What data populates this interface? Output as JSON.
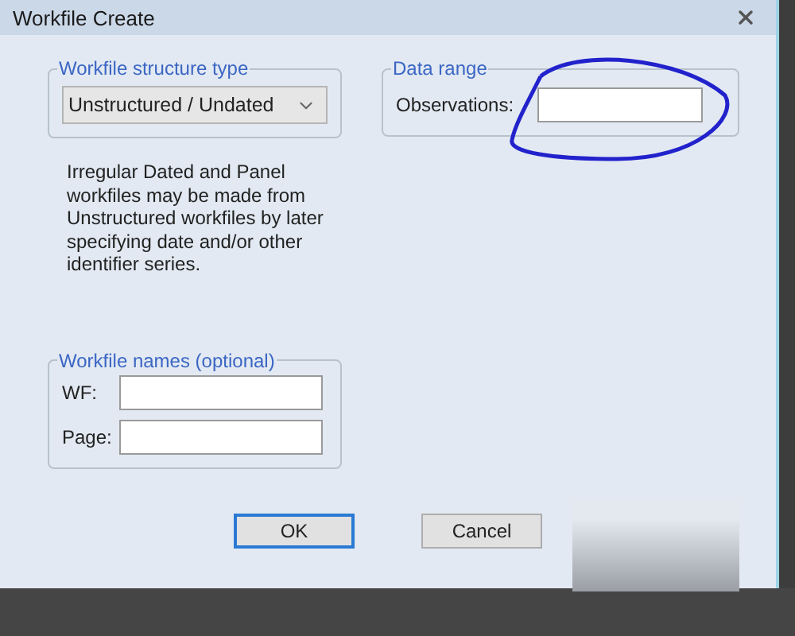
{
  "window": {
    "title": "Workfile Create"
  },
  "structure_group": {
    "label": "Workfile structure type",
    "dropdown": {
      "value": "Unstructured / Undated"
    }
  },
  "description": "Irregular Dated and Panel workfiles may be made from Unstructured workfiles by later specifying date and/or other identifier series.",
  "data_range": {
    "label": "Data range",
    "fields": [
      {
        "label": "Observations:"
      }
    ]
  },
  "names_group": {
    "label": "Workfile names (optional)",
    "fields": [
      {
        "label": "WF:"
      },
      {
        "label": "Page:"
      }
    ]
  },
  "buttons": [
    {
      "label": "OK",
      "default": true
    },
    {
      "label": "Cancel",
      "default": false
    }
  ]
}
